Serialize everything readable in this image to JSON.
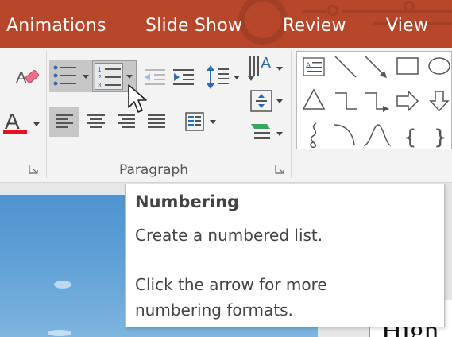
{
  "tabs": [
    {
      "label": "Animations"
    },
    {
      "label": "Slide Show"
    },
    {
      "label": "Review"
    },
    {
      "label": "View"
    }
  ],
  "ribbon": {
    "paragraph_group_label": "Paragraph",
    "icons": {
      "clear_formatting": "eraser-icon",
      "font_color": "font-color-icon",
      "bullets": "bullets-icon",
      "numbering": "numbering-icon",
      "decrease_indent": "decrease-indent-icon",
      "increase_indent": "increase-indent-icon",
      "line_spacing": "line-spacing-icon",
      "text_direction": "text-direction-icon",
      "align_text": "align-text-icon",
      "convert_smartart": "smartart-icon",
      "align_left": "align-left-icon",
      "center": "center-icon",
      "align_right": "align-right-icon",
      "justify": "justify-icon",
      "columns": "columns-icon"
    },
    "font_color_swatch": "#e81123",
    "numbering_marks": [
      "1",
      "2",
      "3"
    ]
  },
  "tooltip": {
    "title": "Numbering",
    "line1": "Create a numbered list.",
    "line2": "Click the arrow for more",
    "line3": "numbering formats."
  },
  "slide": {
    "right_text": "High"
  },
  "colors": {
    "ribbon_tab_bg": "#b7472a",
    "ribbon_body_bg": "#f3f3f3",
    "pressed_bg": "#c7c7c7"
  }
}
